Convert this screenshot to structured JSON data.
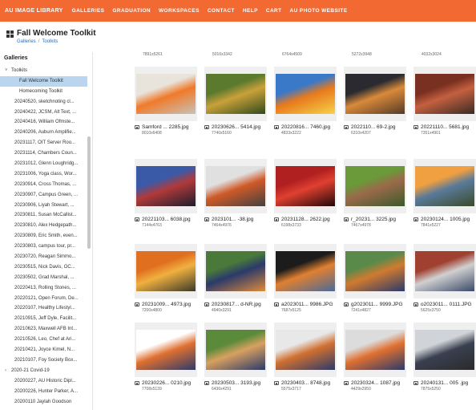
{
  "topnav": {
    "brand": "AU IMAGE LIBRARY",
    "items": [
      "GALLERIES",
      "GRADUATION",
      "WORKSPACES",
      "CONTACT",
      "HELP",
      "CART",
      "AU PHOTO WEBSITE"
    ],
    "accent": "#f26a32"
  },
  "header": {
    "title": "Fall Welcome Toolkit",
    "breadcrumb": [
      "Galleries",
      "Toolkits"
    ]
  },
  "sidebar": {
    "title": "Galleries",
    "items": [
      {
        "label": "Toolkits",
        "type": "expanded"
      },
      {
        "label": "Fall Welcome Toolkit",
        "type": "child",
        "selected": true
      },
      {
        "label": "Homecoming Toolkit",
        "type": "child"
      },
      {
        "label": "20240520, sketchnoting cl...",
        "type": "leaf"
      },
      {
        "label": "20240422, JCSM, Alt Text, ...",
        "type": "leaf"
      },
      {
        "label": "20240416, William Ofmste...",
        "type": "leaf"
      },
      {
        "label": "20240206, Auburn Amplifie...",
        "type": "leaf"
      },
      {
        "label": "20231117, OIT Server Roo...",
        "type": "leaf"
      },
      {
        "label": "20231114, Chambers Coun...",
        "type": "leaf"
      },
      {
        "label": "20231012, Glenn Loughridg...",
        "type": "leaf"
      },
      {
        "label": "20231006, Yoga class, Wor...",
        "type": "leaf"
      },
      {
        "label": "20230914, Cross Thomas, ...",
        "type": "leaf"
      },
      {
        "label": "20230907, Campus Green, ...",
        "type": "leaf"
      },
      {
        "label": "20230906, Liyah Stewart, ...",
        "type": "leaf"
      },
      {
        "label": "20230811, Susan McCallist...",
        "type": "leaf"
      },
      {
        "label": "20230810, Alex Hedgepath...",
        "type": "leaf"
      },
      {
        "label": "20230809, Eric Smith, even...",
        "type": "leaf"
      },
      {
        "label": "20230803, campus tour, pr...",
        "type": "leaf"
      },
      {
        "label": "20230720, Reagan Simmo...",
        "type": "leaf"
      },
      {
        "label": "20230515, Nick Davis, OC...",
        "type": "leaf"
      },
      {
        "label": "20230502, Grad Marshal, ...",
        "type": "leaf"
      },
      {
        "label": "20220413, Rolling Stones, ...",
        "type": "leaf"
      },
      {
        "label": "20220121, Open Forum, De...",
        "type": "leaf"
      },
      {
        "label": "20220107, Healthy Lifestyl...",
        "type": "leaf"
      },
      {
        "label": "20210915, Jeff Dyle, Facilit...",
        "type": "leaf"
      },
      {
        "label": "20210623, Maxwell AFB Int...",
        "type": "leaf"
      },
      {
        "label": "20210526, Leo, Chef at Ari...",
        "type": "leaf"
      },
      {
        "label": "20210421, Joyce Kimel, N...",
        "type": "leaf"
      },
      {
        "label": "20210107, Foy Society Box...",
        "type": "leaf"
      },
      {
        "label": "2020-21 Covid-19",
        "type": "collapsed"
      },
      {
        "label": "20200227, AU Historic Dipl...",
        "type": "leaf"
      },
      {
        "label": "20200226, Hunter Parker, A...",
        "type": "leaf"
      },
      {
        "label": "20200110 Jaylah Goodson",
        "type": "leaf"
      }
    ]
  },
  "gallery": {
    "top_dims": [
      "7891x5261",
      "5016x3342",
      "6764x4509",
      "5272x3948",
      "4032x3024"
    ],
    "tiles": [
      {
        "name": "Samford ... 2285.jpg",
        "dims": "8010x6408",
        "colors": [
          "#e8e4dc",
          "#f07a2a",
          "#c8c2b8"
        ]
      },
      {
        "name": "20230626... 5414.jpg",
        "dims": "7740x5160",
        "colors": [
          "#5c7a2e",
          "#c9a13a",
          "#2f4a1c"
        ]
      },
      {
        "name": "20220816... 7460.jpg",
        "dims": "4833x3222",
        "colors": [
          "#3a78c8",
          "#e87a1c",
          "#f5d34a"
        ]
      },
      {
        "name": "2022110... 69-2.jpg",
        "dims": "6310x4207",
        "colors": [
          "#2a2a30",
          "#d98a3a",
          "#553a28"
        ]
      },
      {
        "name": "20221110... 5681.jpg",
        "dims": "7351x4901",
        "colors": [
          "#7a3020",
          "#c46040",
          "#3a2a24"
        ]
      },
      {
        "name": "20221103... 6038.jpg",
        "dims": "7144x4763",
        "colors": [
          "#3a5aa8",
          "#b03a3a",
          "#1c1c2c"
        ]
      },
      {
        "name": "2023101... -38.jpg",
        "dims": "7464x4976",
        "colors": [
          "#e0e0e0",
          "#d05a28",
          "#404040"
        ]
      },
      {
        "name": "20231128... 2622.jpg",
        "dims": "6198x3733",
        "colors": [
          "#b02020",
          "#e04030",
          "#200808"
        ]
      },
      {
        "name": "r_20231... 3225.jpg",
        "dims": "7467x4978",
        "colors": [
          "#6a9a3a",
          "#9a6a4a",
          "#3a5a2a"
        ]
      },
      {
        "name": "20230124... 1005.jpg",
        "dims": "7841x5227",
        "colors": [
          "#f0a040",
          "#5a7a9a",
          "#3a4a2a"
        ]
      },
      {
        "name": "20231009... 4973.jpg",
        "dims": "7200x4800",
        "colors": [
          "#e07020",
          "#f0b040",
          "#3a3a2a"
        ]
      },
      {
        "name": "20230817... d-NR.jpg",
        "dims": "4940x3291",
        "colors": [
          "#4a7a3a",
          "#2a3a6a",
          "#e08a3a"
        ]
      },
      {
        "name": "a2023011... 9986.JPG",
        "dims": "7687x5125",
        "colors": [
          "#1c1c1c",
          "#e08030",
          "#4a6a9a"
        ]
      },
      {
        "name": "g2023011... 9999.JPG",
        "dims": "7241x4827",
        "colors": [
          "#5a8a4a",
          "#d07a30",
          "#2a3a6a"
        ]
      },
      {
        "name": "o2023011... 0111.JPG",
        "dims": "5625x3750",
        "colors": [
          "#a04030",
          "#d0d0d0",
          "#3a4a6a"
        ]
      },
      {
        "name": "20230226... 0210.jpg",
        "dims": "7708x5139",
        "colors": [
          "#ffffff",
          "#e07030",
          "#2a3a6a"
        ]
      },
      {
        "name": "20230503... 3193.jpg",
        "dims": "6436x4291",
        "colors": [
          "#5a8a3a",
          "#d8a060",
          "#2a3a6a"
        ]
      },
      {
        "name": "20230403... 8748.jpg",
        "dims": "5575x3717",
        "colors": [
          "#e8e8e8",
          "#d07030",
          "#2a3a6a"
        ]
      },
      {
        "name": "20230324... 1087.jpg",
        "dims": "4429x2950",
        "colors": [
          "#dcdcdc",
          "#e07030",
          "#2a3a6a"
        ]
      },
      {
        "name": "20240131... 005 .jpg",
        "dims": "7875x5250",
        "colors": [
          "#d0d4d8",
          "#3a4050",
          "#2a2a2a"
        ]
      }
    ]
  }
}
